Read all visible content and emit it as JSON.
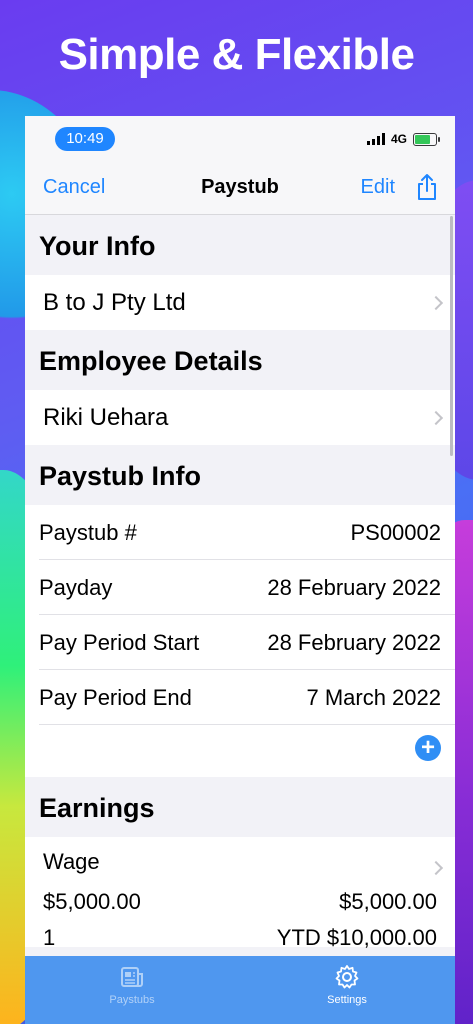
{
  "headline": "Simple & Flexible",
  "status_bar": {
    "time": "10:49",
    "network": "4G"
  },
  "nav": {
    "cancel_label": "Cancel",
    "title": "Paystub",
    "edit_label": "Edit"
  },
  "your_info": {
    "header": "Your Info",
    "company": "B to J Pty Ltd"
  },
  "employee": {
    "header": "Employee Details",
    "name": "Riki Uehara"
  },
  "paystub_info": {
    "header": "Paystub Info",
    "rows": [
      {
        "label": "Paystub #",
        "value": "PS00002"
      },
      {
        "label": "Payday",
        "value": "28 February 2022"
      },
      {
        "label": "Pay Period Start",
        "value": "28 February 2022"
      },
      {
        "label": "Pay Period End",
        "value": "7 March 2022"
      }
    ],
    "add_symbol": "+"
  },
  "earnings": {
    "header": "Earnings",
    "item": {
      "name": "Wage",
      "rate": "$5,000.00",
      "amount": "$5,000.00",
      "quantity": "1",
      "ytd": "YTD $10,000.00"
    }
  },
  "tabbar": {
    "paystubs_label": "Paystubs",
    "settings_label": "Settings"
  },
  "colors": {
    "accent": "#1f86ff",
    "tabbar": "#4f97ef",
    "battery": "#34c759"
  }
}
